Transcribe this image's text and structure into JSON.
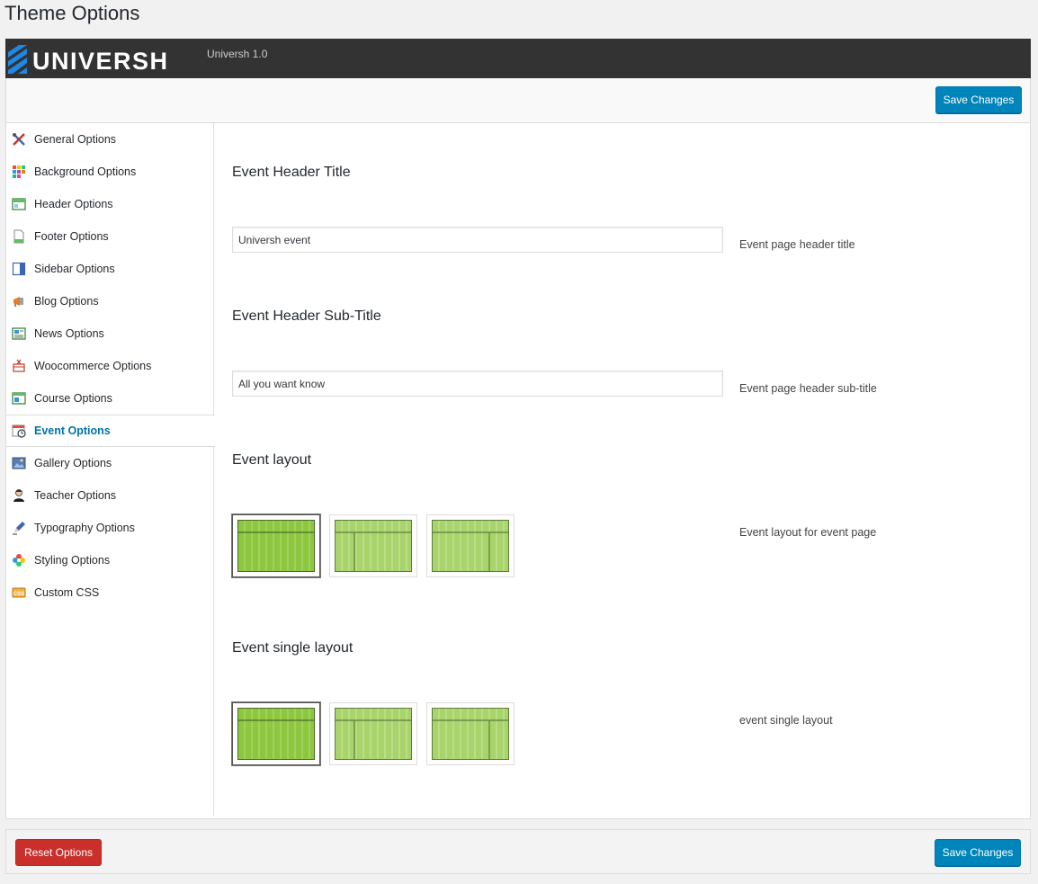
{
  "page_title": "Theme Options",
  "brand": {
    "logo_text": "UNIVERSH",
    "version": "Universh 1.0"
  },
  "toolbar": {
    "save_label": "Save Changes"
  },
  "sidebar": {
    "items": [
      {
        "label": "General Options",
        "icon": "tools-icon"
      },
      {
        "label": "Background Options",
        "icon": "palette-icon"
      },
      {
        "label": "Header Options",
        "icon": "header-layout-icon"
      },
      {
        "label": "Footer Options",
        "icon": "footer-page-icon"
      },
      {
        "label": "Sidebar Options",
        "icon": "sidebar-layout-icon"
      },
      {
        "label": "Blog Options",
        "icon": "megaphone-icon"
      },
      {
        "label": "News Options",
        "icon": "newspaper-icon"
      },
      {
        "label": "Woocommerce Options",
        "icon": "cart-icon"
      },
      {
        "label": "Course Options",
        "icon": "course-window-icon"
      },
      {
        "label": "Event Options",
        "icon": "calendar-clock-icon"
      },
      {
        "label": "Gallery Options",
        "icon": "picture-icon"
      },
      {
        "label": "Teacher Options",
        "icon": "person-icon"
      },
      {
        "label": "Typography Options",
        "icon": "pen-icon"
      },
      {
        "label": "Styling Options",
        "icon": "flower-icon"
      },
      {
        "label": "Custom CSS",
        "icon": "css-badge-icon"
      }
    ],
    "active_index": 9
  },
  "main": {
    "event_header_title": {
      "title": "Event Header Title",
      "value": "Universh event",
      "description": "Event page header title"
    },
    "event_header_subtitle": {
      "title": "Event Header Sub-Title",
      "value": "All you want know",
      "description": "Event page header sub-title"
    },
    "event_layout": {
      "title": "Event layout",
      "description": "Event layout for event page",
      "options": [
        "full-width",
        "left-sidebar",
        "right-sidebar"
      ],
      "selected_index": 0
    },
    "event_single_layout": {
      "title": "Event single layout",
      "description": "event single layout",
      "options": [
        "full-width",
        "left-sidebar",
        "right-sidebar"
      ],
      "selected_index": 0
    }
  },
  "footer": {
    "reset_label": "Reset Options",
    "save_label": "Save Changes"
  },
  "colors": {
    "topbar_bg": "#333333",
    "primary_button": "#0085ba",
    "reset_button": "#c9302c",
    "active_nav": "#0073aa",
    "layout_green": "#8dc63f",
    "layout_green_light": "#a8d46b"
  }
}
